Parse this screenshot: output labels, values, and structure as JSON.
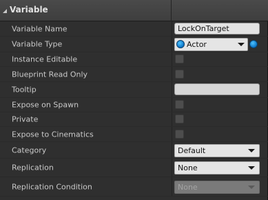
{
  "section": {
    "title": "Variable"
  },
  "rows": {
    "variable_name": {
      "label": "Variable Name",
      "value": "LockOnTarget"
    },
    "variable_type": {
      "label": "Variable Type",
      "value": "Actor",
      "pin_color": "#1aa3f2"
    },
    "instance_editable": {
      "label": "Instance Editable",
      "checked": false
    },
    "blueprint_read_only": {
      "label": "Blueprint Read Only",
      "checked": false
    },
    "tooltip": {
      "label": "Tooltip",
      "value": ""
    },
    "expose_on_spawn": {
      "label": "Expose on Spawn",
      "checked": false
    },
    "private": {
      "label": "Private",
      "checked": false
    },
    "expose_to_cinematics": {
      "label": "Expose to Cinematics",
      "checked": false
    },
    "category": {
      "label": "Category",
      "value": "Default"
    },
    "replication": {
      "label": "Replication",
      "value": "None"
    },
    "replication_condition": {
      "label": "Replication Condition",
      "value": "None",
      "enabled": false
    }
  }
}
